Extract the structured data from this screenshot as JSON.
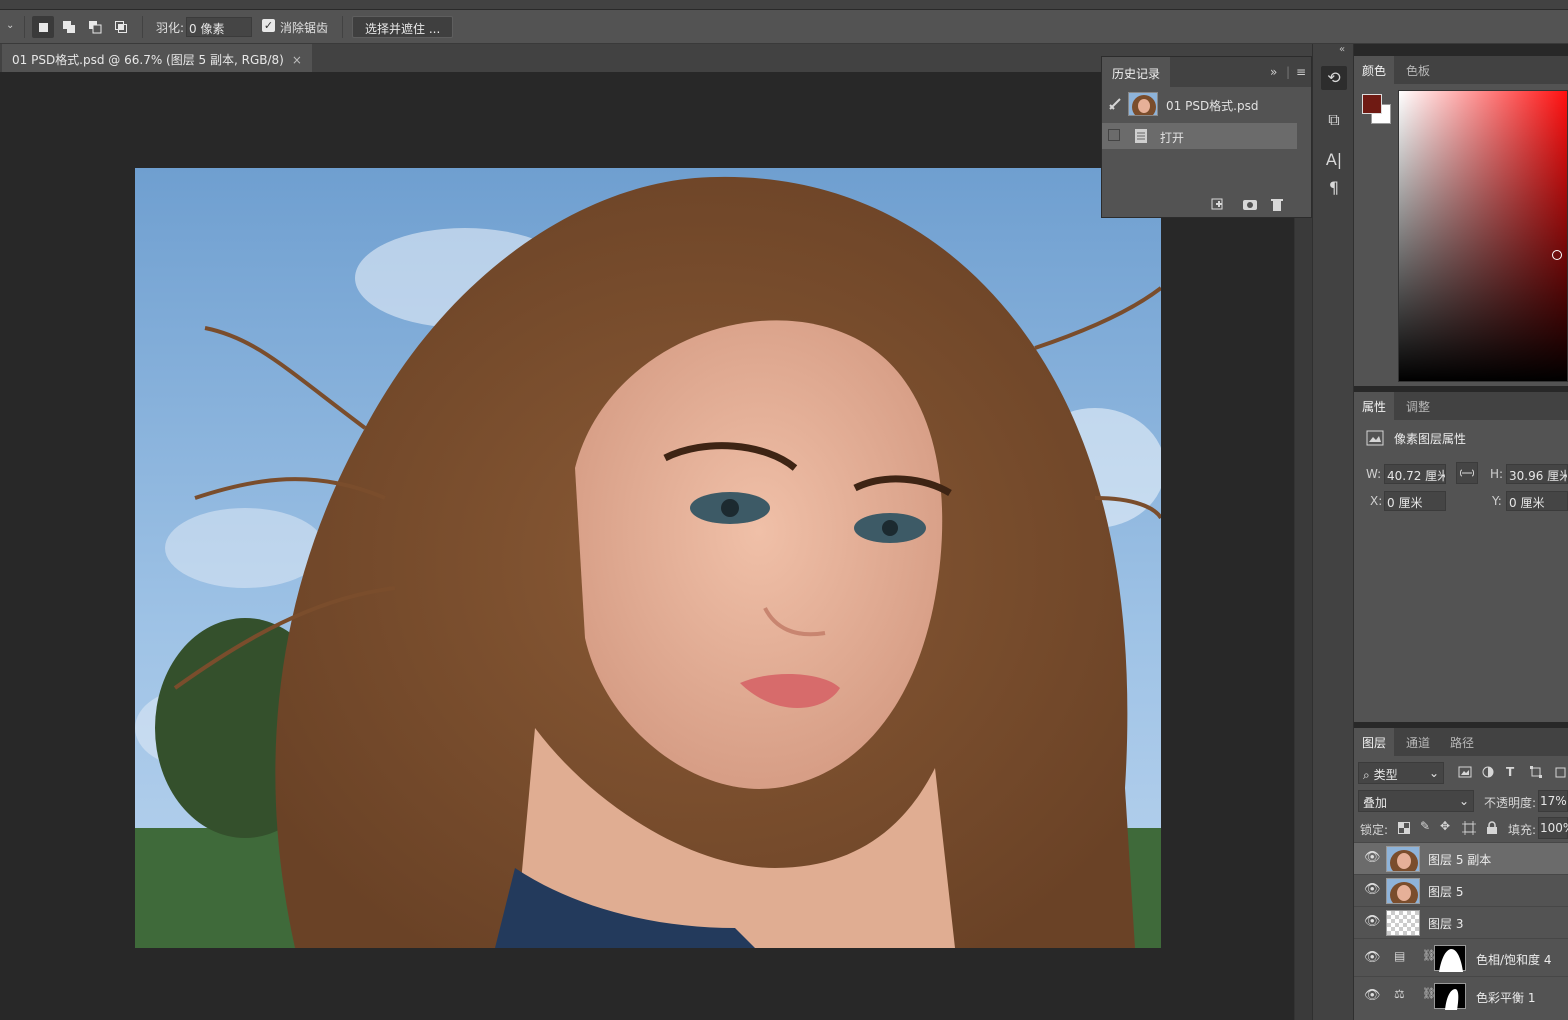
{
  "options_bar": {
    "feather_label": "羽化:",
    "feather_value": "0 像素",
    "antialias_label": "消除锯齿",
    "antialias_checked": true,
    "select_mask_button": "选择并遮住 ..."
  },
  "document": {
    "tab_title": "01 PSD格式.psd @ 66.7% (图层 5 副本, RGB/8)",
    "close_glyph": "×"
  },
  "history": {
    "tab_label": "历史记录",
    "collapse_glyph": "»",
    "menu_glyph": "≡",
    "snapshot_name": "01 PSD格式.psd",
    "items": [
      {
        "label": "打开"
      }
    ]
  },
  "color_panel": {
    "tabs": [
      "颜色",
      "色板"
    ],
    "foreground_color": "#6f1a13",
    "background_color": "#ffffff"
  },
  "properties_panel": {
    "tabs": [
      "属性",
      "调整"
    ],
    "title": "像素图层属性",
    "w_label": "W:",
    "w_value": "40.72 厘米",
    "h_label": "H:",
    "h_value": "30.96 厘米",
    "x_label": "X:",
    "x_value": "0 厘米",
    "y_label": "Y:",
    "y_value": "0 厘米"
  },
  "layers_panel": {
    "tabs": [
      "图层",
      "通道",
      "路径"
    ],
    "filter_label": "类型",
    "blend_mode": "叠加",
    "opacity_label": "不透明度:",
    "opacity_value": "17%",
    "lock_label": "锁定:",
    "fill_label": "填充:",
    "fill_value": "100%",
    "layers": [
      {
        "name": "图层 5 副本",
        "type": "photo",
        "selected": true
      },
      {
        "name": "图层 5",
        "type": "photo",
        "selected": false
      },
      {
        "name": "图层 3",
        "type": "transparent",
        "selected": false
      },
      {
        "name": "色相/饱和度 4",
        "type": "adjustment-hue",
        "selected": false
      },
      {
        "name": "色彩平衡 1",
        "type": "adjustment-balance",
        "selected": false
      }
    ]
  }
}
